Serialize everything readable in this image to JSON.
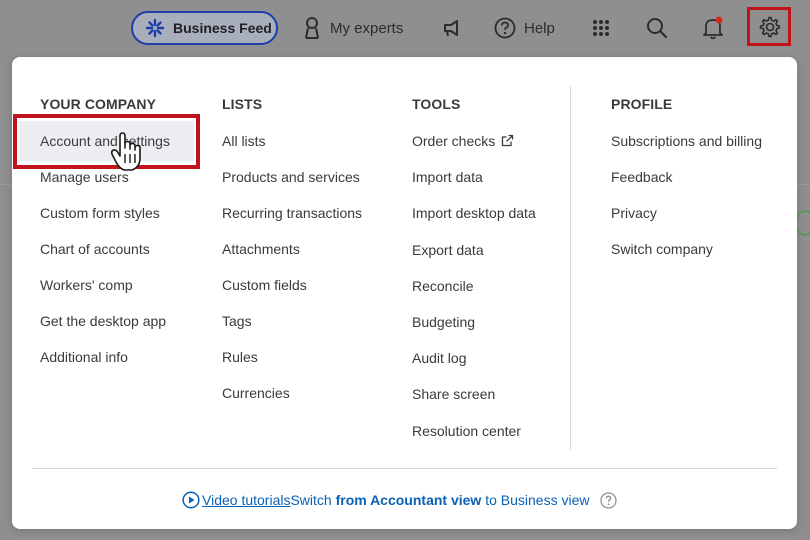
{
  "topbar": {
    "business_feed": "Business Feed",
    "my_experts": "My experts",
    "help": "Help"
  },
  "menu": {
    "your_company": {
      "heading": "YOUR COMPANY",
      "items": [
        "Account and settings",
        "Manage users",
        "Custom form styles",
        "Chart of accounts",
        "Workers' comp",
        "Get the desktop app",
        "Additional info"
      ]
    },
    "lists": {
      "heading": "LISTS",
      "items": [
        "All lists",
        "Products and services",
        "Recurring transactions",
        "Attachments",
        "Custom fields",
        "Tags",
        "Rules",
        "Currencies"
      ]
    },
    "tools": {
      "heading": "TOOLS",
      "items": [
        "Order checks",
        "Import data",
        "Import desktop data",
        "Export data",
        "Reconcile",
        "Budgeting",
        "Audit log",
        "Share screen",
        "Resolution center"
      ]
    },
    "profile": {
      "heading": "PROFILE",
      "items": [
        "Subscriptions and billing",
        "Feedback",
        "Privacy",
        "Switch company"
      ]
    }
  },
  "footer": {
    "video_tutorials": "Video tutorials",
    "switch_prefix": "Switch ",
    "switch_bold": "from Accountant view",
    "switch_suffix": " to Business view"
  },
  "colors": {
    "highlight": "#c0141c",
    "link": "#0a61b7",
    "notification_dot": "#d52b1e"
  }
}
